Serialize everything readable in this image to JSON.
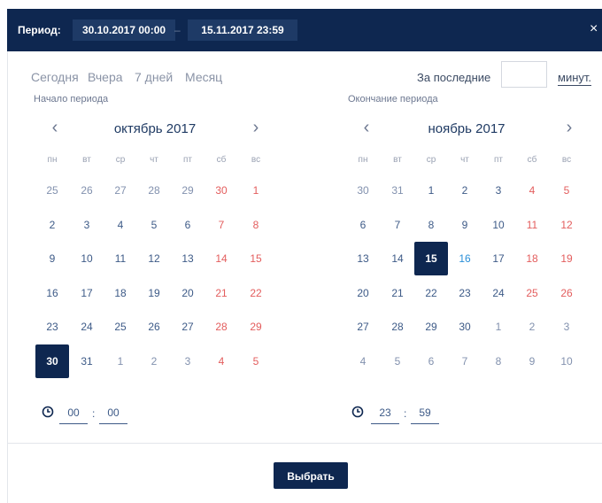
{
  "header": {
    "label": "Период:",
    "start": "30.10.2017 00:00",
    "separator": "–",
    "end": "15.11.2017 23:59",
    "close": "×"
  },
  "quick": [
    "Сегодня",
    "Вчера",
    "7 дней",
    "Месяц"
  ],
  "last": {
    "label": "За последние",
    "value": "",
    "unit": "минут."
  },
  "left": {
    "title": "Начало периода",
    "month": "октябрь 2017",
    "weekdays": [
      "пн",
      "вт",
      "ср",
      "чт",
      "пт",
      "сб",
      "вс"
    ],
    "days": [
      "25",
      "26",
      "27",
      "28",
      "29",
      "30",
      "1",
      "2",
      "3",
      "4",
      "5",
      "6",
      "7",
      "8",
      "9",
      "10",
      "11",
      "12",
      "13",
      "14",
      "15",
      "16",
      "17",
      "18",
      "19",
      "20",
      "21",
      "22",
      "23",
      "24",
      "25",
      "26",
      "27",
      "28",
      "29",
      "30",
      "31",
      "1",
      "2",
      "3",
      "4",
      "5"
    ],
    "selected_index": 35,
    "other_month_range": [],
    "time": {
      "hours": "00",
      "minutes": "00",
      "sep": ":"
    }
  },
  "right": {
    "title": "Окончание периода",
    "month": "ноябрь 2017",
    "weekdays": [
      "пн",
      "вт",
      "ср",
      "чт",
      "пт",
      "сб",
      "вс"
    ],
    "days": [
      "30",
      "31",
      "1",
      "2",
      "3",
      "4",
      "5",
      "6",
      "7",
      "8",
      "9",
      "10",
      "11",
      "12",
      "13",
      "14",
      "15",
      "16",
      "17",
      "18",
      "19",
      "20",
      "21",
      "22",
      "23",
      "24",
      "25",
      "26",
      "27",
      "28",
      "29",
      "30",
      "1",
      "2",
      "3",
      "4",
      "5",
      "6",
      "7",
      "8",
      "9",
      "10"
    ],
    "selected_index": 16,
    "today_index": 17,
    "time": {
      "hours": "23",
      "minutes": "59",
      "sep": ":"
    }
  },
  "nav": {
    "prev": "‹",
    "next": "›"
  },
  "choose_label": "Выбрать",
  "colors": {
    "primary": "#0e2750",
    "weekend": "#e35d5d",
    "today": "#2a8fd8",
    "text": "#3d5a87"
  }
}
